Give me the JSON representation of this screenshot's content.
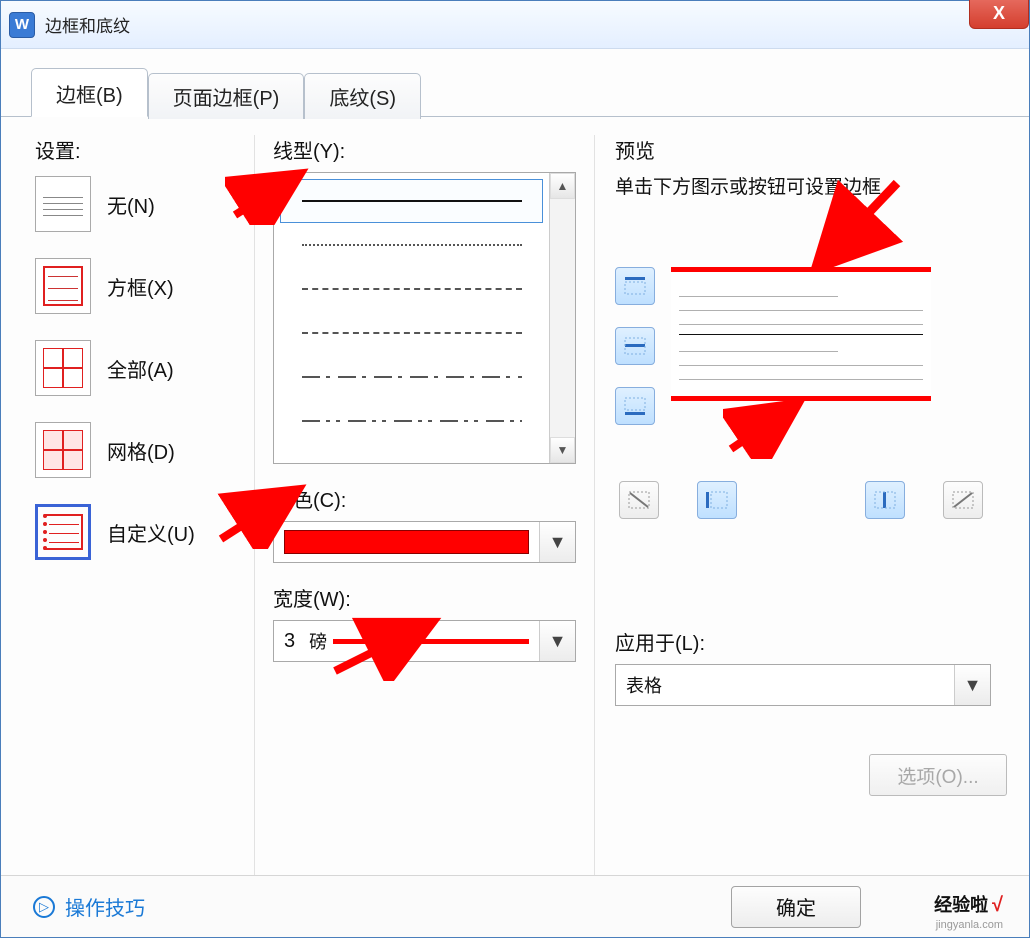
{
  "window": {
    "title": "边框和底纹",
    "close_label": "X"
  },
  "tabs": {
    "borders": "边框(B)",
    "page_borders": "页面边框(P)",
    "shading": "底纹(S)"
  },
  "settings": {
    "label": "设置:",
    "items": [
      {
        "label": "无(N)"
      },
      {
        "label": "方框(X)"
      },
      {
        "label": "全部(A)"
      },
      {
        "label": "网格(D)"
      },
      {
        "label": "自定义(U)"
      }
    ]
  },
  "linetype": {
    "label": "线型(Y):"
  },
  "color": {
    "label": "颜色(C):",
    "value": "#FF0000"
  },
  "width": {
    "label": "宽度(W):",
    "value": "3",
    "unit": "磅"
  },
  "preview": {
    "label": "预览",
    "hint": "单击下方图示或按钮可设置边框"
  },
  "apply_to": {
    "label": "应用于(L):",
    "value": "表格"
  },
  "options_btn": "选项(O)...",
  "footer": {
    "tips": "操作技巧",
    "ok": "确定"
  },
  "watermark": {
    "brand": "经验啦",
    "url": "jingyanla.com"
  }
}
